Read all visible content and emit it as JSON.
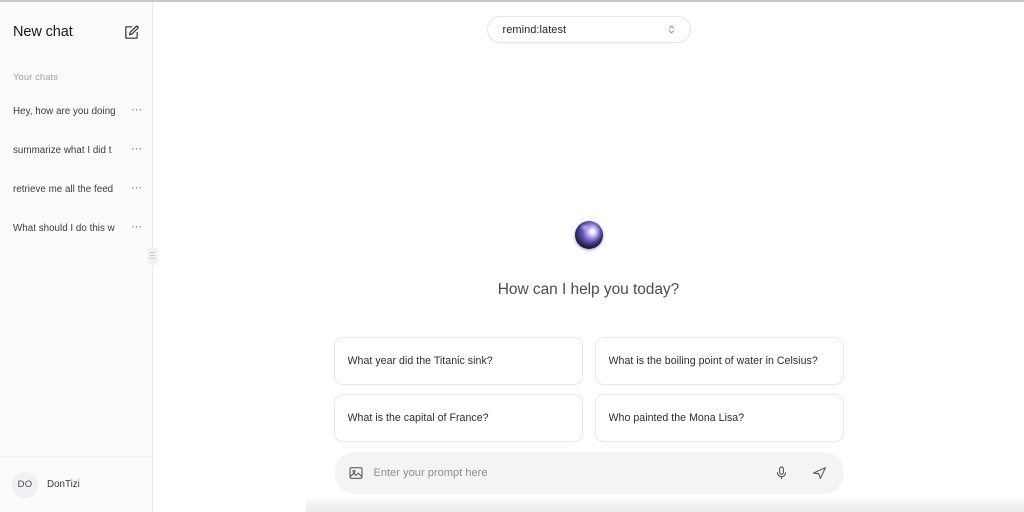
{
  "window": {
    "background": "#ffffff",
    "accent": "#3b3276"
  },
  "sidebar": {
    "new_chat_label": "New chat",
    "compose_icon": "compose-pencil-square-icon",
    "section_label": "Your chats",
    "chats": [
      {
        "title": "Hey, how are you doing",
        "menu_icon": "ellipsis-icon"
      },
      {
        "title": "summarize what I did t",
        "menu_icon": "ellipsis-icon"
      },
      {
        "title": "retrieve me all the feed",
        "menu_icon": "ellipsis-icon"
      },
      {
        "title": "What should I do this w",
        "menu_icon": "ellipsis-icon"
      }
    ],
    "footer": {
      "avatar_initials": "DO",
      "username": "DonTizi"
    },
    "resize_handle_icon": "drag-handle-icon"
  },
  "main": {
    "model_selector": {
      "value": "remind:latest",
      "icon": "chevron-up-down-icon"
    },
    "hero": {
      "logo_icon": "orb-logo-icon",
      "title": "How can I help you today?"
    },
    "suggestions": [
      {
        "text": "What year did the Titanic sink?"
      },
      {
        "text": "What is the boiling point of water in Celsius?"
      },
      {
        "text": "What is the capital of France?"
      },
      {
        "text": "Who painted the Mona Lisa?"
      }
    ],
    "prompt_bar": {
      "attach_icon": "image-attachment-icon",
      "placeholder": "Enter your prompt here",
      "value": "",
      "mic_icon": "microphone-icon",
      "send_icon": "send-paper-plane-icon"
    }
  }
}
